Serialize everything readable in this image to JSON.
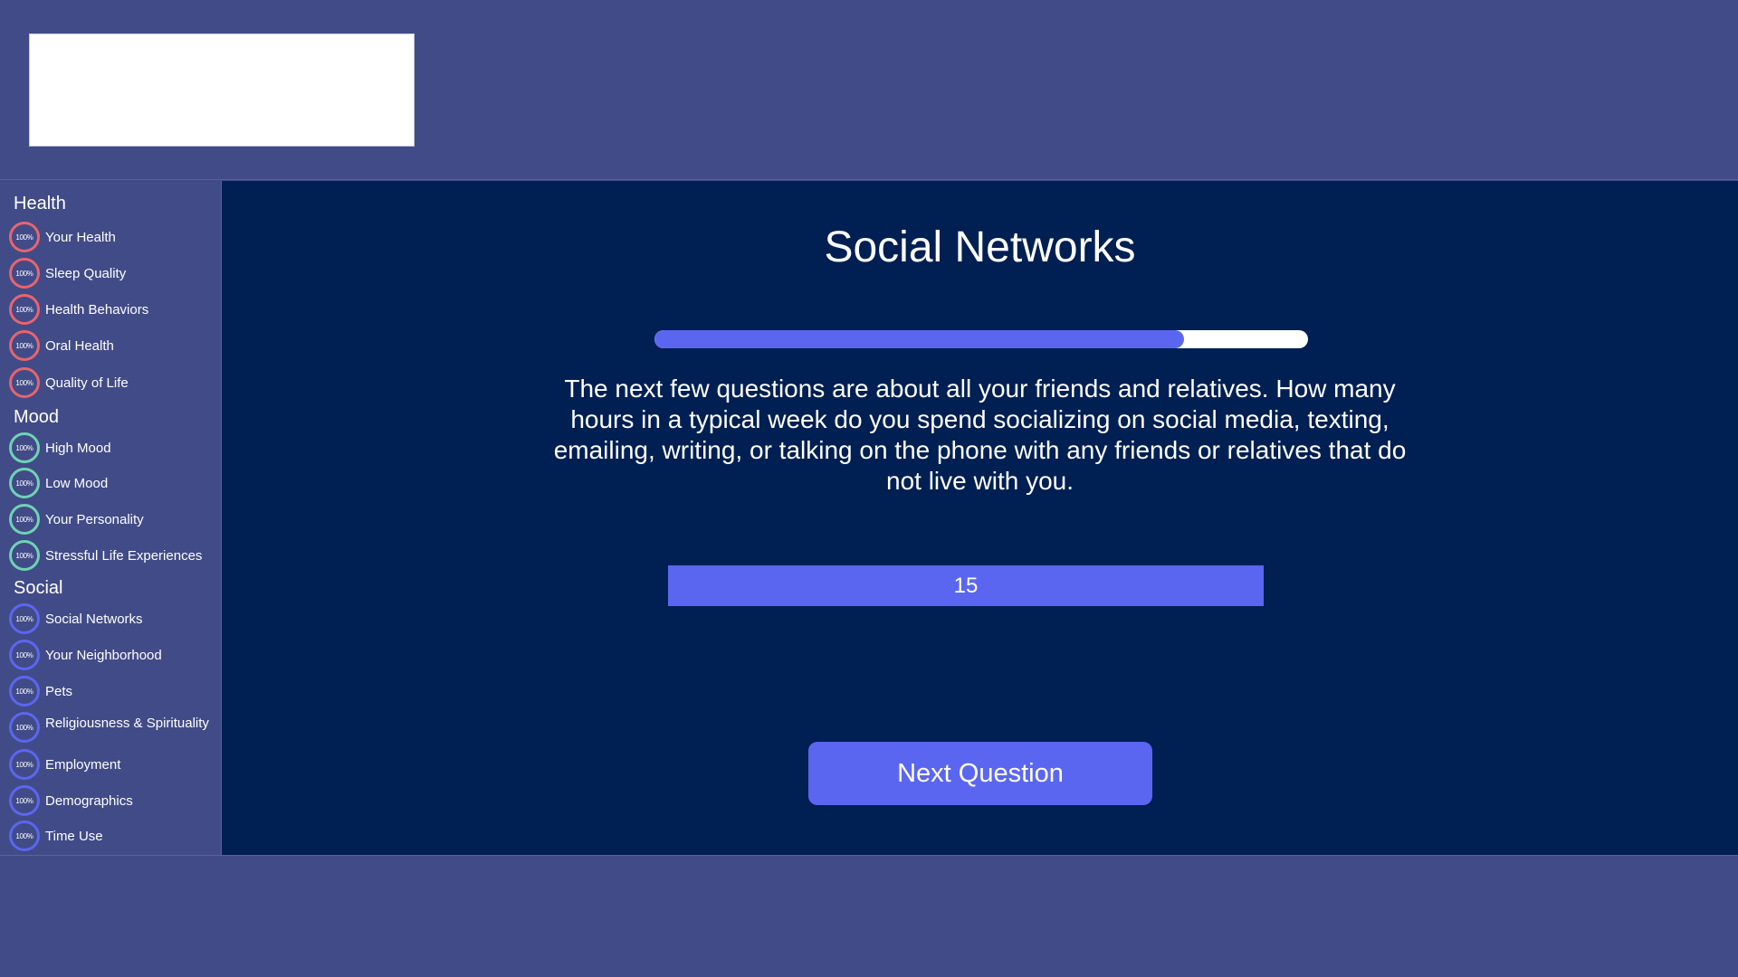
{
  "sidebar": {
    "sections": [
      {
        "title": "Health",
        "color": "#e8646e",
        "items": [
          {
            "label": "Your Health",
            "badge": "100%"
          },
          {
            "label": "Sleep Quality",
            "badge": "100%"
          },
          {
            "label": "Health Behaviors",
            "badge": "100%"
          },
          {
            "label": "Oral Health",
            "badge": "100%"
          },
          {
            "label": "Quality of Life",
            "badge": "100%"
          }
        ]
      },
      {
        "title": "Mood",
        "color": "#6ed3b4",
        "items": [
          {
            "label": "High Mood",
            "badge": "100%"
          },
          {
            "label": "Low Mood",
            "badge": "100%"
          },
          {
            "label": "Your Personality",
            "badge": "100%"
          },
          {
            "label": "Stressful Life Experiences",
            "badge": "100%"
          }
        ]
      },
      {
        "title": "Social",
        "color": "#5b66f0",
        "items": [
          {
            "label": "Social Networks",
            "badge": "100%"
          },
          {
            "label": "Your Neighborhood",
            "badge": "100%"
          },
          {
            "label": "Pets",
            "badge": "100%"
          },
          {
            "label": "Religiousness & Spirituality",
            "badge": "100%"
          },
          {
            "label": "Employment",
            "badge": "100%"
          },
          {
            "label": "Demographics",
            "badge": "100%"
          },
          {
            "label": "Time Use",
            "badge": "100%"
          }
        ]
      }
    ]
  },
  "main": {
    "title": "Social Networks",
    "progress": 0.81,
    "question": "The next few questions are about all your friends and relatives. How many hours in a typical week do you spend socializing on social media, texting, emailing, writing, or talking on the phone with any friends or relatives that do not live with you.",
    "answer_value": "15",
    "next_button_label": "Next Question"
  },
  "colors": {
    "background": "#414b87",
    "main_panel": "#001f52",
    "accent": "#5b66f0"
  }
}
